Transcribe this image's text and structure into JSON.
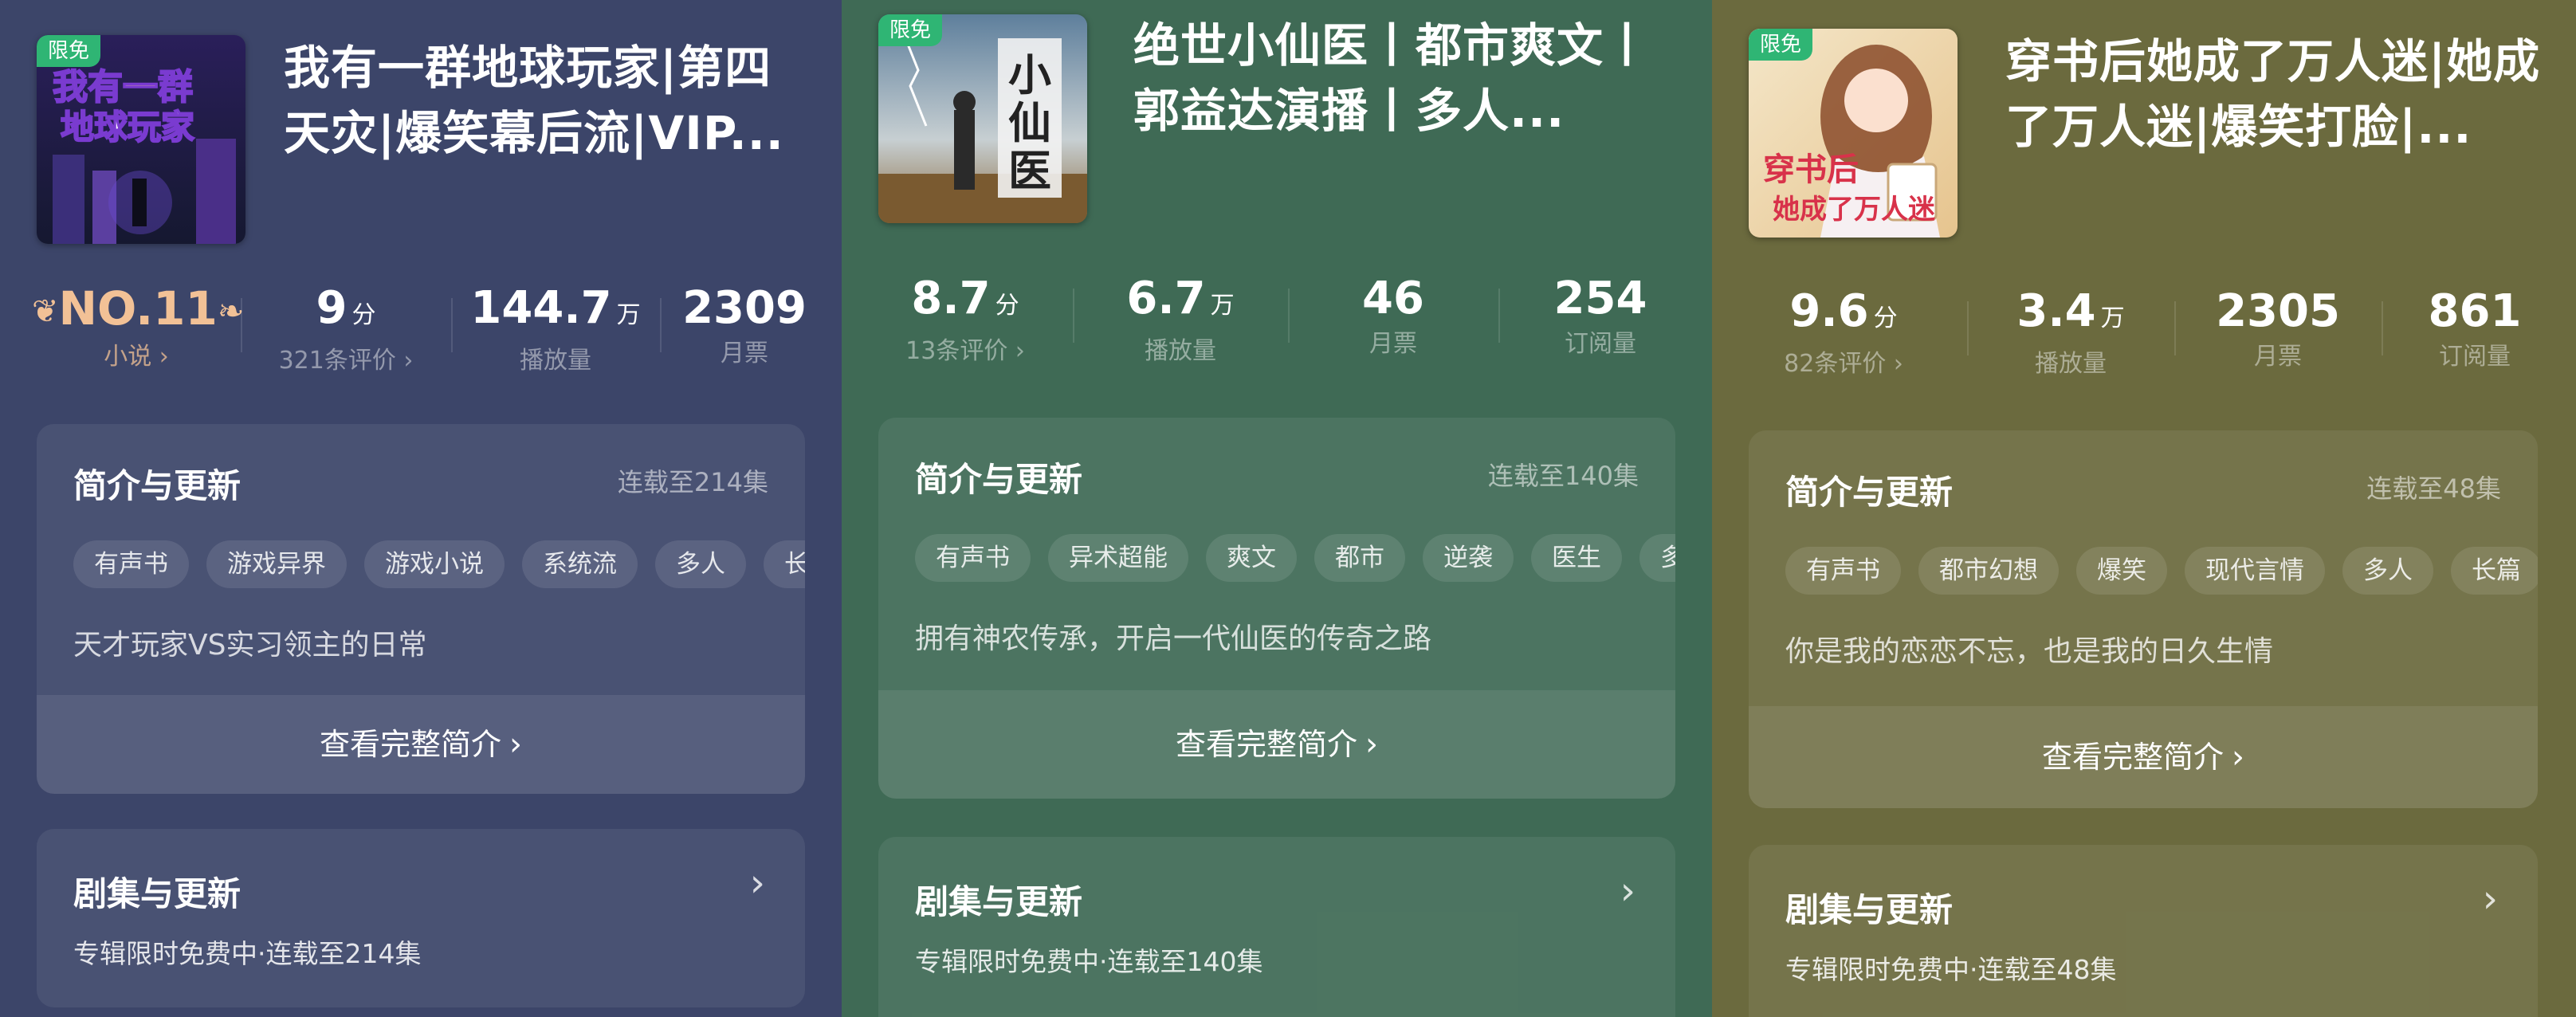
{
  "albums": [
    {
      "badge": "限免",
      "title": "我有一群地球玩家|第四天灾|爆笑幕后流|VIP...",
      "rank": {
        "value": "NO.11",
        "label": "小说 ›"
      },
      "stats": [
        {
          "value": "9",
          "unit": "分",
          "label": "321条评价 ›"
        },
        {
          "value": "144.7",
          "unit": "万",
          "label": "播放量"
        },
        {
          "value": "2309",
          "unit": "",
          "label": "月票"
        }
      ],
      "intro": {
        "heading": "简介与更新",
        "status": "连载至214集",
        "tags": [
          "有声书",
          "游戏异界",
          "游戏小说",
          "系统流",
          "多人",
          "长篇"
        ],
        "description": "天才玩家VS实习领主的日常",
        "more_label": "查看完整简介"
      },
      "episodes": {
        "heading": "剧集与更新",
        "subtitle": "专辑限时免费中·连载至214集"
      }
    },
    {
      "badge": "限免",
      "title": "绝世小仙医丨都市爽文丨郭益达演播丨多人...",
      "stats": [
        {
          "value": "8.7",
          "unit": "分",
          "label": "13条评价 ›"
        },
        {
          "value": "6.7",
          "unit": "万",
          "label": "播放量"
        },
        {
          "value": "46",
          "unit": "",
          "label": "月票"
        },
        {
          "value": "254",
          "unit": "",
          "label": "订阅量"
        }
      ],
      "intro": {
        "heading": "简介与更新",
        "status": "连载至140集",
        "tags": [
          "有声书",
          "异术超能",
          "爽文",
          "都市",
          "逆袭",
          "医生",
          "多人"
        ],
        "description": "拥有神农传承，开启一代仙医的传奇之路",
        "more_label": "查看完整简介"
      },
      "episodes": {
        "heading": "剧集与更新",
        "subtitle": "专辑限时免费中·连载至140集"
      }
    },
    {
      "badge": "限免",
      "title": "穿书后她成了万人迷|她成了万人迷|爆笑打脸|...",
      "stats": [
        {
          "value": "9.6",
          "unit": "分",
          "label": "82条评价 ›"
        },
        {
          "value": "3.4",
          "unit": "万",
          "label": "播放量"
        },
        {
          "value": "2305",
          "unit": "",
          "label": "月票"
        },
        {
          "value": "861",
          "unit": "",
          "label": "订阅量"
        }
      ],
      "intro": {
        "heading": "简介与更新",
        "status": "连载至48集",
        "tags": [
          "有声书",
          "都市幻想",
          "爆笑",
          "现代言情",
          "多人",
          "长篇"
        ],
        "description": "你是我的恋恋不忘，也是我的日久生情",
        "more_label": "查看完整简介"
      },
      "episodes": {
        "heading": "剧集与更新",
        "subtitle": "专辑限时免费中·连载至48集"
      }
    }
  ],
  "colors": {
    "panel_0": "#3c4569",
    "panel_1": "#3f6a55",
    "panel_2": "#6b6a3e",
    "free_badge": "#2fb574",
    "rank": "#f2c196"
  }
}
